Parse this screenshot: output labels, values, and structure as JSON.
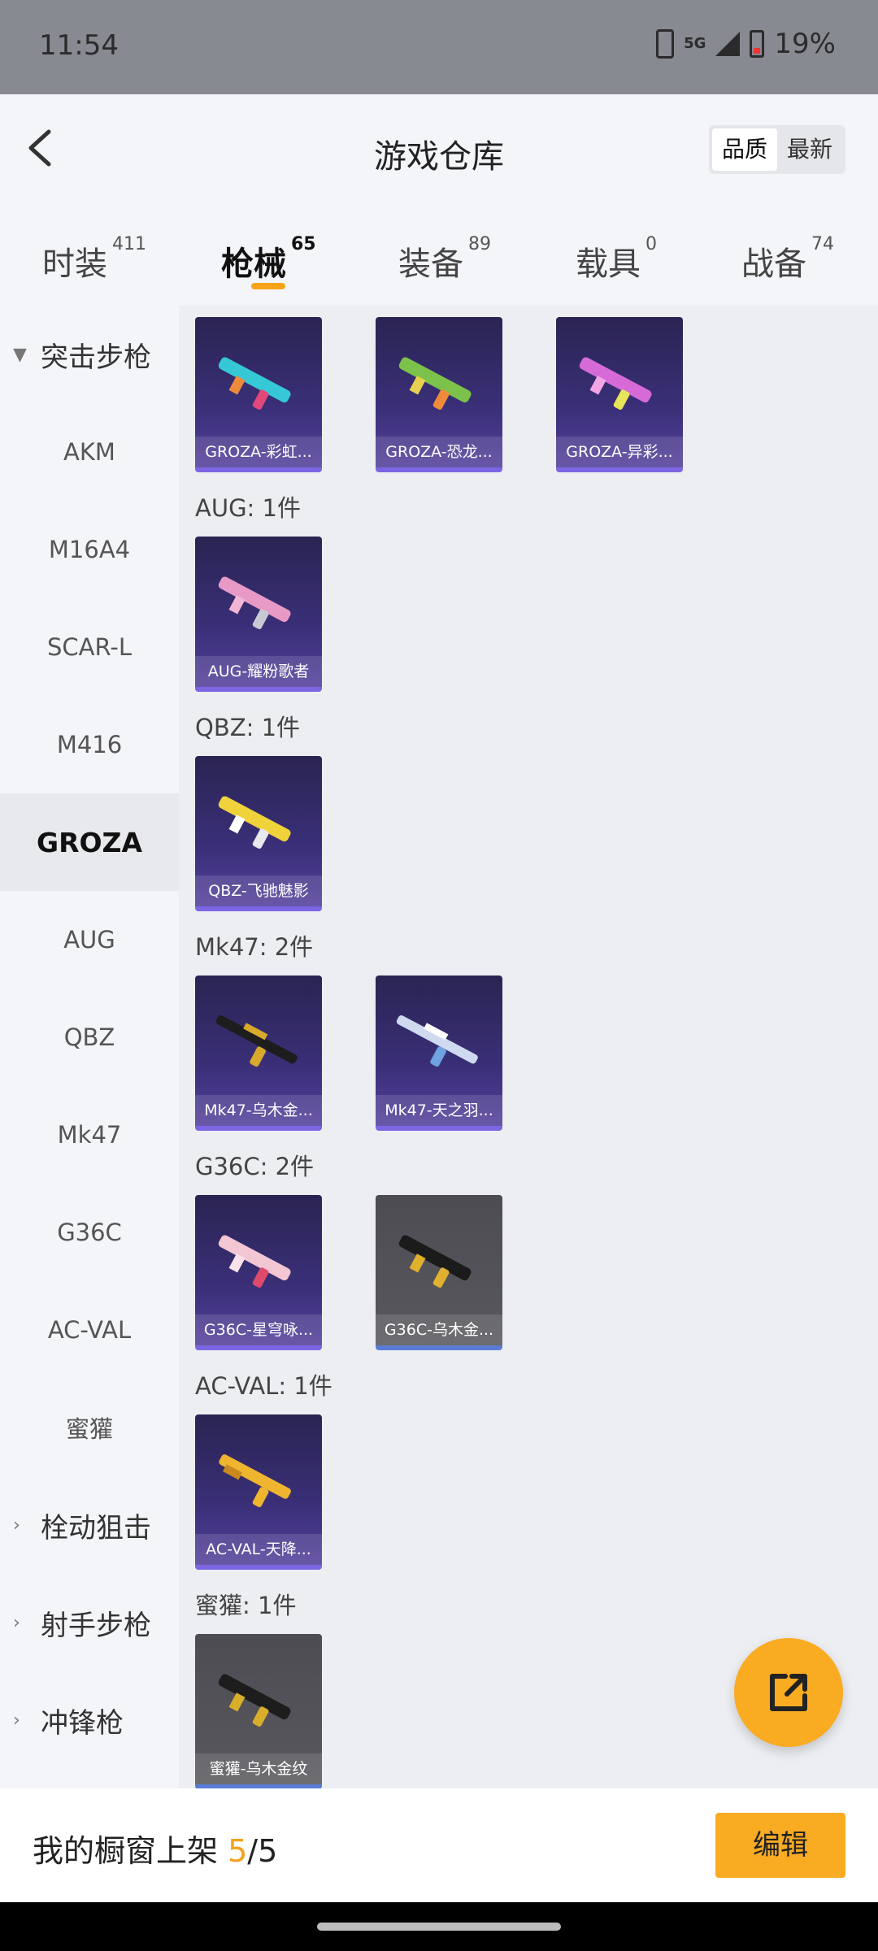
{
  "status_bar": {
    "time": "11:54",
    "network": "5G",
    "battery": "19%"
  },
  "header": {
    "title": "游戏仓库",
    "sort_options": [
      "品质",
      "最新"
    ],
    "sort_selected": "品质"
  },
  "tabs": [
    {
      "label": "时装",
      "count": "411"
    },
    {
      "label": "枪械",
      "count": "65",
      "active": true
    },
    {
      "label": "装备",
      "count": "89"
    },
    {
      "label": "载具",
      "count": "0"
    },
    {
      "label": "战备",
      "count": "74"
    }
  ],
  "sidebar": {
    "expanded_group": "突击步枪",
    "items": [
      "AKM",
      "M16A4",
      "SCAR-L",
      "M416",
      "GROZA",
      "AUG",
      "QBZ",
      "Mk47",
      "G36C",
      "AC-VAL",
      "蜜獾"
    ],
    "active_item": "GROZA",
    "collapsed_groups": [
      "栓动狙击",
      "射手步枪",
      "冲锋枪"
    ]
  },
  "content": {
    "groza_cards": [
      "GROZA-彩虹...",
      "GROZA-恐龙...",
      "GROZA-异彩..."
    ],
    "sections": [
      {
        "label": "AUG: 1件",
        "cards": [
          "AUG-耀粉歌者"
        ]
      },
      {
        "label": "QBZ: 1件",
        "cards": [
          "QBZ-飞驰魅影"
        ]
      },
      {
        "label": "Mk47: 2件",
        "cards": [
          "Mk47-乌木金...",
          "Mk47-天之羽..."
        ]
      },
      {
        "label": "G36C: 2件",
        "cards": [
          "G36C-星穹咏...",
          "G36C-乌木金..."
        ]
      },
      {
        "label": "AC-VAL: 1件",
        "cards": [
          "AC-VAL-天降..."
        ]
      },
      {
        "label": "蜜獾: 1件",
        "cards": [
          "蜜獾-乌木金纹"
        ]
      }
    ]
  },
  "bottom_bar": {
    "prefix": "我的橱窗上架 ",
    "current": "5",
    "total": "/5",
    "edit_label": "编辑"
  },
  "colors": {
    "accent": "#f9ab22",
    "card_purple": "#3a2f78",
    "card_grey": "#55555b"
  },
  "icons": {
    "back": "chevron-left-icon",
    "fab": "share-external-icon"
  }
}
